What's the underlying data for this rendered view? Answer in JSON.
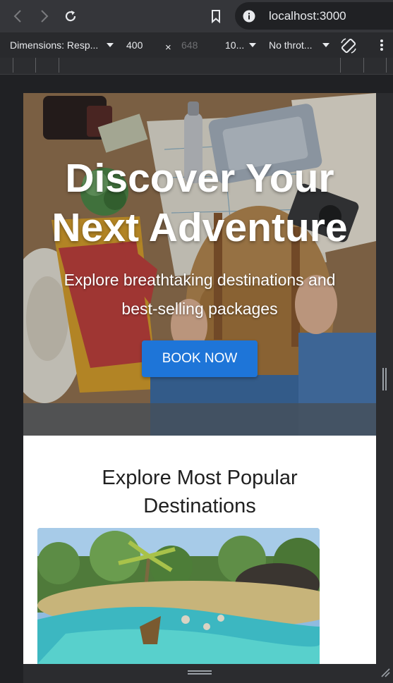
{
  "browser": {
    "url": "localhost:3000"
  },
  "devtools": {
    "dimensions_label": "Dimensions: Resp...",
    "width_value": "400",
    "times": "×",
    "height_value": "648",
    "zoom_label": "10...",
    "throttle_label": "No throt..."
  },
  "hero": {
    "title_line1": "Discover Your",
    "title_line2": "Next Adventure",
    "subtitle_line1": "Explore breathtaking destinations and",
    "subtitle_line2": "best-selling packages",
    "button_label": "BOOK NOW",
    "button_color": "#1e75d8"
  },
  "section": {
    "title_line1": "Explore Most Popular",
    "title_line2": "Destinations"
  },
  "icons": [
    "back-icon",
    "forward-icon",
    "reload-icon",
    "bookmark-icon",
    "info-icon",
    "rotate-icon",
    "more-vert-icon"
  ]
}
